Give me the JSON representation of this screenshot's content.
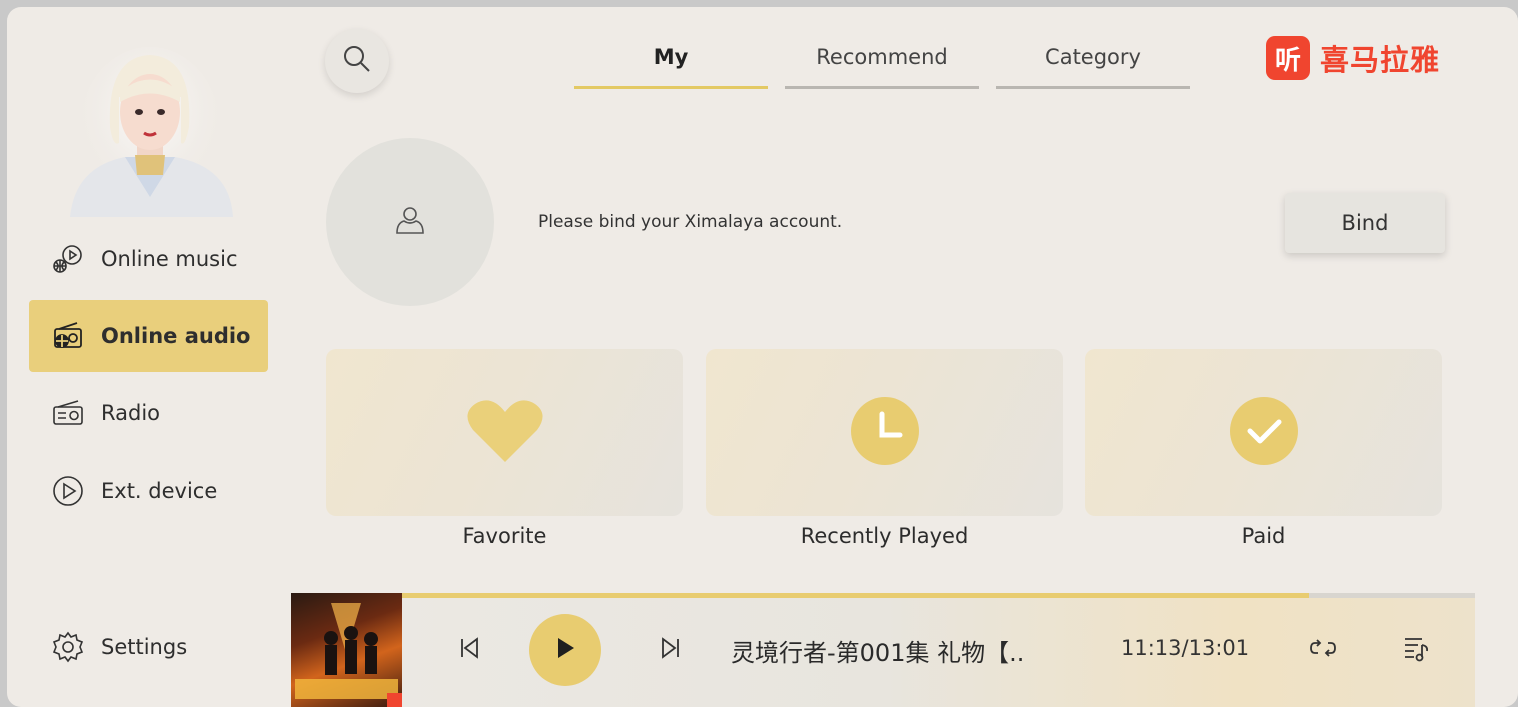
{
  "sidebar": {
    "items": [
      {
        "label": "Online music",
        "icon": "globe-music-icon"
      },
      {
        "label": "Online audio",
        "icon": "radio-globe-icon",
        "active": true
      },
      {
        "label": "Radio",
        "icon": "radio-icon"
      },
      {
        "label": "Ext. device",
        "icon": "play-circle-icon"
      }
    ],
    "settings_label": "Settings"
  },
  "tabs": [
    {
      "label": "My",
      "active": true
    },
    {
      "label": "Recommend"
    },
    {
      "label": "Category"
    }
  ],
  "brand": {
    "badge": "听",
    "name": "喜马拉雅"
  },
  "account": {
    "message": "Please bind your Ximalaya account.",
    "bind_label": "Bind"
  },
  "cards": [
    {
      "label": "Favorite",
      "icon": "heart-icon"
    },
    {
      "label": "Recently Played",
      "icon": "clock-icon"
    },
    {
      "label": "Paid",
      "icon": "check-icon"
    }
  ],
  "player": {
    "title": "灵境行者-第001集 礼物【..",
    "time": "11:13/13:01",
    "progress": 0.86
  },
  "colors": {
    "accent": "#e8cc70",
    "background": "#efebe6",
    "brand": "#f0452f"
  }
}
